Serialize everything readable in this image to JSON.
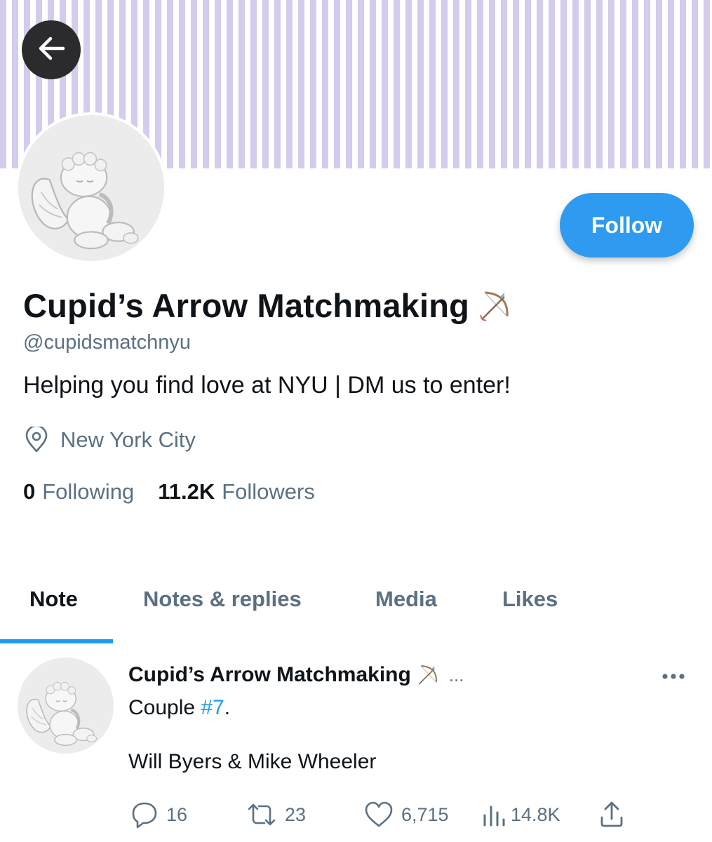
{
  "profile": {
    "name": "Cupid’s Arrow Matchmaking",
    "name_emoji": "🏹",
    "handle": "@cupidsmatchnyu",
    "bio": "Helping you find love at NYU | DM us to enter!",
    "location": "New York City",
    "following_count": "0",
    "following_label": "Following",
    "followers_count": "11.2K",
    "followers_label": "Followers",
    "follow_button": "Follow"
  },
  "tabs": [
    {
      "label": "Note",
      "active": true
    },
    {
      "label": "Notes & replies",
      "active": false
    },
    {
      "label": "Media",
      "active": false
    },
    {
      "label": "Likes",
      "active": false
    }
  ],
  "tweet": {
    "author": "Cupid’s Arrow Matchmaking",
    "author_emoji": "🏹",
    "truncation": "...",
    "text_prefix": "Couple ",
    "hashtag": "#7",
    "text_suffix": ".",
    "line2": "Will Byers & Mike Wheeler",
    "replies": "16",
    "retweets": "23",
    "likes": "6,715",
    "views": "14.8K"
  },
  "colors": {
    "banner_stripe": "#d5cbec",
    "accent": "#1d9bf0",
    "follow_button": "#2e9bf0",
    "secondary_text": "#5b7083",
    "back_button": "#2b2b2e"
  },
  "icons": [
    "back-arrow-icon",
    "location-pin-icon",
    "bow-arrow-icon",
    "more-icon",
    "reply-icon",
    "retweet-icon",
    "like-icon",
    "views-icon",
    "share-icon"
  ]
}
